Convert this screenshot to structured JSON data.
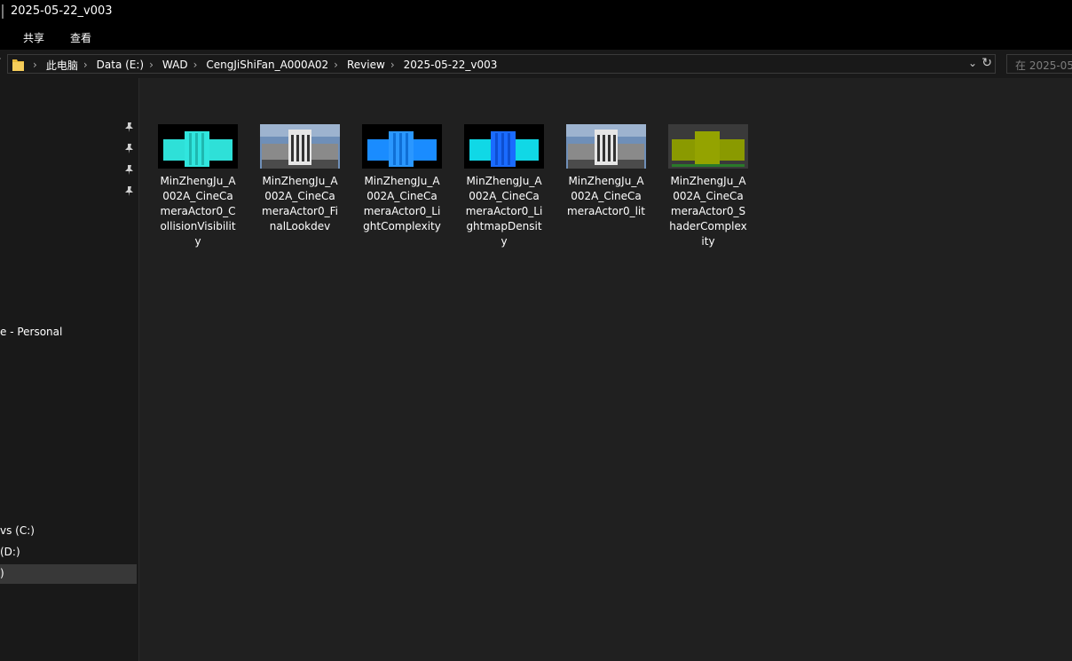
{
  "window": {
    "title": "2025-05-22_v003"
  },
  "ribbon": {
    "tabs": [
      "共享",
      "查看"
    ]
  },
  "address": {
    "crumbs": [
      "此电脑",
      "Data (E:)",
      "WAD",
      "CengJiShiFan_A000A02",
      "Review",
      "2025-05-22_v003"
    ],
    "dropdown_icon": "chevron-down-icon",
    "refresh_icon": "refresh-icon"
  },
  "search": {
    "placeholder": "在 2025-05"
  },
  "nav": {
    "onedrive_label": "e - Personal",
    "drives": [
      {
        "label": "vs (C:)"
      },
      {
        "label": "(D:)"
      },
      {
        "label": ")"
      }
    ]
  },
  "files": [
    {
      "name": "MinZhengJu_A002A_CineCameraActor0_CollisionVisibility",
      "thumb": "collision"
    },
    {
      "name": "MinZhengJu_A002A_CineCameraActor0_FinalLookdev",
      "thumb": "lit"
    },
    {
      "name": "MinZhengJu_A002A_CineCameraActor0_LightComplexity",
      "thumb": "light-complexity"
    },
    {
      "name": "MinZhengJu_A002A_CineCameraActor0_LightmapDensity",
      "thumb": "lightmap-density"
    },
    {
      "name": "MinZhengJu_A002A_CineCameraActor0_lit",
      "thumb": "lit"
    },
    {
      "name": "MinZhengJu_A002A_CineCameraActor0_ShaderComplexity",
      "thumb": "shader-complexity"
    }
  ],
  "colors": {
    "collision": "#2ee0d8",
    "light_complexity": "#1a8cff",
    "lightmap_density_main": "#1a6bff",
    "lightmap_density_side": "#10d8e6",
    "shader_complexity": "#8a9a00",
    "lit_sky": "#6f8fb8"
  }
}
